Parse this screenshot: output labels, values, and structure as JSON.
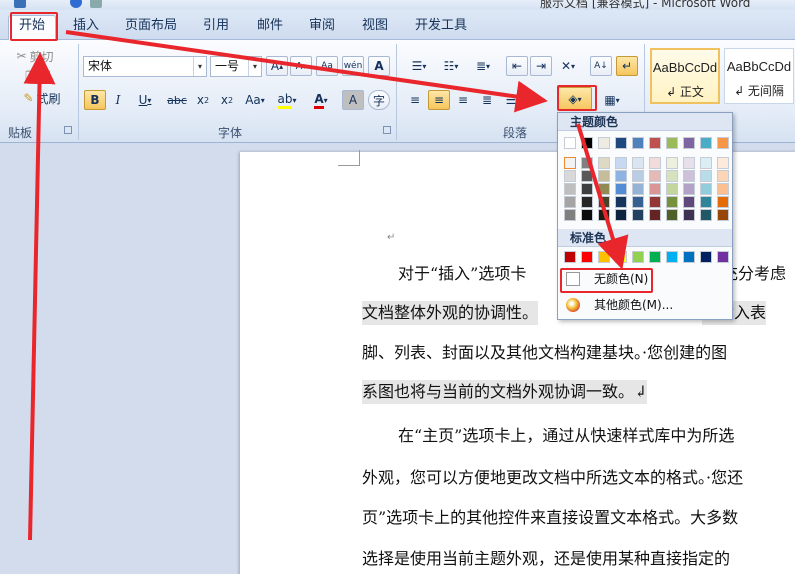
{
  "window": {
    "title": "服示文档 [兼容模式] - Microsoft Word"
  },
  "tabs": [
    {
      "label": "开始",
      "active": true
    },
    {
      "label": "插入"
    },
    {
      "label": "页面布局"
    },
    {
      "label": "引用"
    },
    {
      "label": "邮件"
    },
    {
      "label": "审阅"
    },
    {
      "label": "视图"
    },
    {
      "label": "开发工具"
    }
  ],
  "clipboard": {
    "cut": "剪切",
    "copy": "制",
    "format_painter": "式刷",
    "label": "贴板"
  },
  "font": {
    "name": "宋体",
    "size": "一号",
    "label": "字体"
  },
  "paragraph": {
    "label": "段落"
  },
  "styles": [
    {
      "sample": "AaBbCcDd",
      "name": "↲ 正文",
      "selected": true
    },
    {
      "sample": "AaBbCcDd",
      "name": "↲ 无间隔"
    }
  ],
  "color_panel": {
    "theme_header": "主题颜色",
    "standard_header": "标准色",
    "no_color": "无颜色(N)",
    "more_colors": "其他颜色(M)...",
    "theme_top": [
      "#ffffff",
      "#000000",
      "#eeece1",
      "#1f497d",
      "#4f81bd",
      "#c0504d",
      "#9bbb59",
      "#8064a2",
      "#4bacc6",
      "#f79646"
    ],
    "theme_shades": [
      [
        "#f2f2f2",
        "#808080",
        "#ddd9c3",
        "#c6d9f0",
        "#dbe5f1",
        "#f2dcdb",
        "#ebf1dd",
        "#e5e0ec",
        "#dbeef3",
        "#fdeada"
      ],
      [
        "#d8d8d8",
        "#595959",
        "#c4bd97",
        "#8db3e2",
        "#b8cce4",
        "#e5b9b7",
        "#d7e3bc",
        "#ccc1d9",
        "#b7dde8",
        "#fbd5b5"
      ],
      [
        "#bfbfbf",
        "#3f3f3f",
        "#938953",
        "#548dd4",
        "#95b3d7",
        "#d99694",
        "#c3d69b",
        "#b2a2c7",
        "#92cddc",
        "#fac08f"
      ],
      [
        "#a5a5a5",
        "#262626",
        "#494429",
        "#17365d",
        "#366092",
        "#953734",
        "#76923c",
        "#5f497a",
        "#31859b",
        "#e36c09"
      ],
      [
        "#7f7f7f",
        "#0c0c0c",
        "#1d1b10",
        "#0f243e",
        "#244061",
        "#632423",
        "#4f6128",
        "#3f3151",
        "#205867",
        "#974806"
      ]
    ],
    "standard": [
      "#c00000",
      "#ff0000",
      "#ffc000",
      "#ffff00",
      "#92d050",
      "#00b050",
      "#00b0f0",
      "#0070c0",
      "#002060",
      "#7030a0"
    ]
  },
  "document": {
    "lines": [
      {
        "text": "对于“插入”选项卡",
        "hl": false,
        "indent": true
      },
      {
        "text": "充分考虑",
        "hl": false,
        "indent": false
      },
      {
        "text": "文档整体外观的协调性。",
        "hl": true,
        "indent": false
      },
      {
        "text": "来插入表",
        "hl": true,
        "indent": false
      },
      {
        "text": "脚、列表、封面以及其他文档构建基块。·您创建的图",
        "hl": false,
        "indent": false
      },
      {
        "text": "系图也将与当前的文档外观协调一致。↲",
        "hl": true,
        "indent": false
      },
      {
        "text": "在“主页”选项卡上，通过从快速样式库中为所选",
        "hl": false,
        "indent": true
      },
      {
        "text": "外观，您可以方便地更改文档中所选文本的格式。·您还",
        "hl": false,
        "indent": false
      },
      {
        "text": "页”选项卡上的其他控件来直接设置文本格式。大多数",
        "hl": false,
        "indent": false
      },
      {
        "text": "选择是使用当前主题外观，还是使用某种直接指定的",
        "hl": false,
        "indent": false
      }
    ]
  }
}
